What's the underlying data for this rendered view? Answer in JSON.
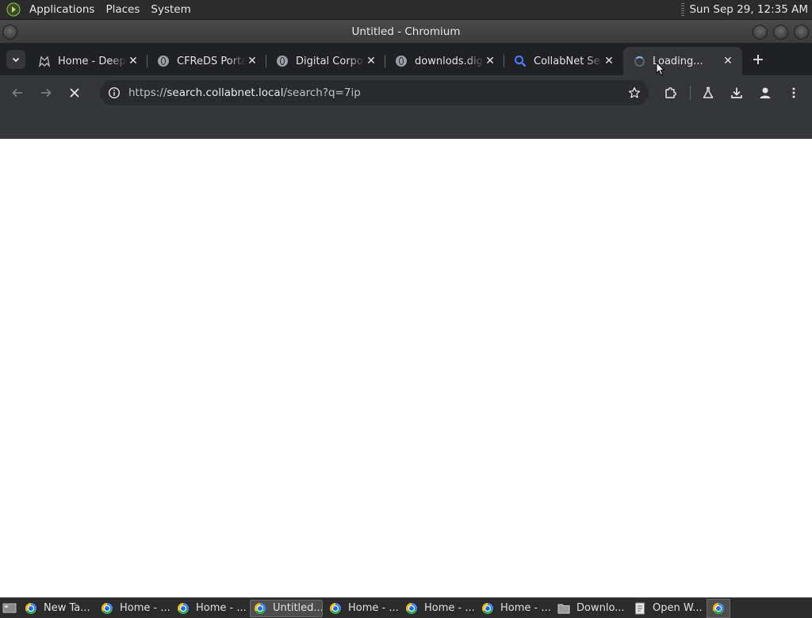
{
  "top_panel": {
    "menus": [
      "Applications",
      "Places",
      "System"
    ],
    "clock": "Sun Sep 29, 12:35 AM"
  },
  "window": {
    "title": "Untitled - Chromium"
  },
  "tabs": [
    {
      "label": "Home - Deep",
      "icon": "ghost-icon"
    },
    {
      "label": "CFReDS Porta",
      "icon": "globe-icon"
    },
    {
      "label": "Digital Corpo",
      "icon": "globe-icon"
    },
    {
      "label": "downlods.dig",
      "icon": "globe-icon"
    },
    {
      "label": "CollabNet Se",
      "icon": "search-icon"
    },
    {
      "label": "Loading...",
      "icon": "spinner-icon",
      "active": true
    }
  ],
  "omnibox": {
    "url_scheme": "https://",
    "url_host": "search.collabnet.local",
    "url_path": "/search?q=7ip"
  },
  "taskbar": {
    "tasks": [
      {
        "label": "New Ta...",
        "icon": "chromium-icon"
      },
      {
        "label": "Home - ...",
        "icon": "chromium-icon"
      },
      {
        "label": "Home - ...",
        "icon": "chromium-icon"
      },
      {
        "label": "Untitled...",
        "icon": "chromium-icon",
        "active": true
      },
      {
        "label": "Home - ...",
        "icon": "chromium-icon"
      },
      {
        "label": "Home - ...",
        "icon": "chromium-icon"
      },
      {
        "label": "Home - ...",
        "icon": "chromium-icon"
      },
      {
        "label": "Downlo...",
        "icon": "folder-icon"
      },
      {
        "label": "Open W...",
        "icon": "document-icon"
      }
    ]
  }
}
